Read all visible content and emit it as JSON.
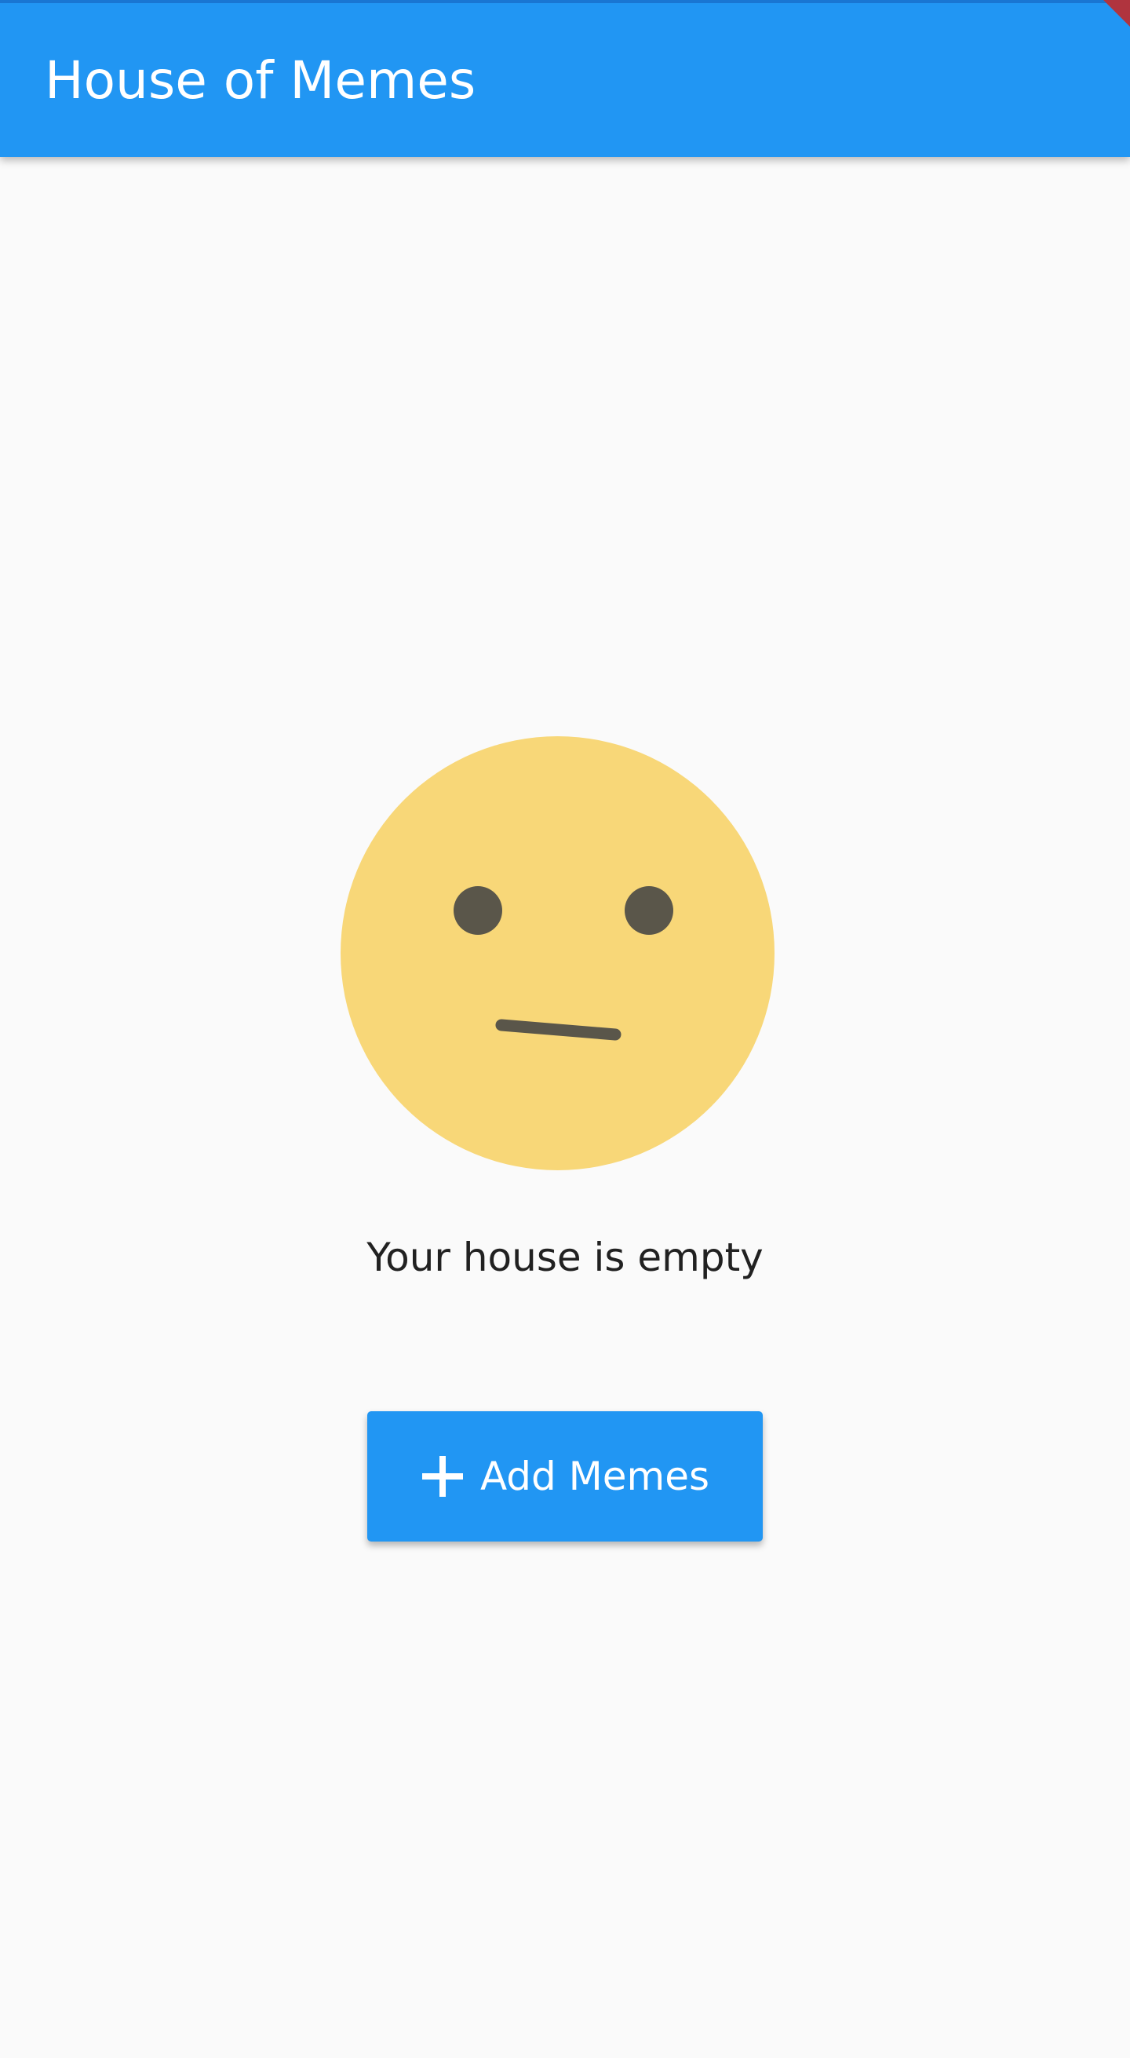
{
  "app_bar": {
    "title": "House of Memes",
    "color": "#2196F3"
  },
  "empty_state": {
    "icon": "neutral-face-icon",
    "face_color": "#F8D778",
    "feature_color": "#5A564A",
    "message": "Your house is empty"
  },
  "add_button": {
    "icon": "plus-icon",
    "label": "Add Memes",
    "color": "#2196F3"
  }
}
